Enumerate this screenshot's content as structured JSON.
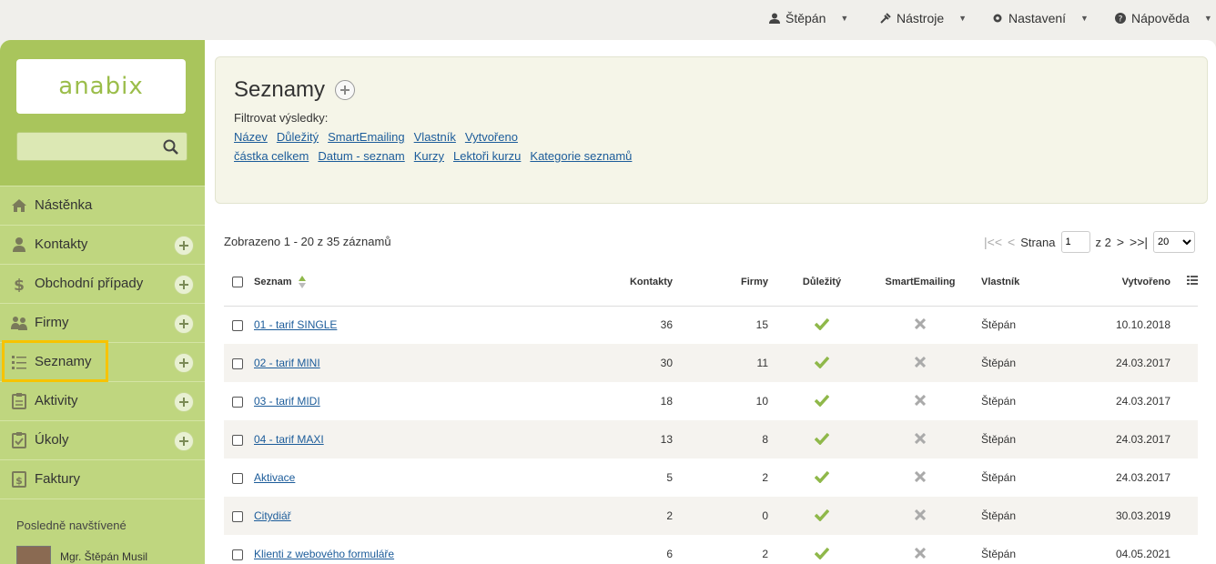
{
  "topbar": {
    "user": "Štěpán",
    "tools": "Nástroje",
    "settings": "Nastavení",
    "help": "Nápověda"
  },
  "sidebar": {
    "logo": "anabix",
    "search_placeholder": "",
    "items": [
      {
        "label": "Nástěnka",
        "icon": "home-icon",
        "plus": false
      },
      {
        "label": "Kontakty",
        "icon": "person-icon",
        "plus": true
      },
      {
        "label": "Obchodní případy",
        "icon": "dollar-icon",
        "plus": true
      },
      {
        "label": "Firmy",
        "icon": "group-icon",
        "plus": true
      },
      {
        "label": "Seznamy",
        "icon": "list-icon",
        "plus": true
      },
      {
        "label": "Aktivity",
        "icon": "clipboard-icon",
        "plus": true
      },
      {
        "label": "Úkoly",
        "icon": "task-icon",
        "plus": true
      },
      {
        "label": "Faktury",
        "icon": "invoice-icon",
        "plus": false
      }
    ],
    "recent_title": "Posledně navštívené",
    "recent_item": "Mgr. Štěpán Musil"
  },
  "main": {
    "title": "Seznamy",
    "filter_label": "Filtrovat výsledky:",
    "filters_row1": [
      "Název",
      "Důležitý",
      "SmartEmailing",
      "Vlastník",
      "Vytvořeno"
    ],
    "filters_row2": [
      "částka celkem",
      "Datum - seznam",
      "Kurzy",
      "Lektoři kurzu",
      "Kategorie seznamů"
    ],
    "showing": "Zobrazeno 1 - 20 z 35 záznamů",
    "pager": {
      "label": "Strana",
      "page": "1",
      "of": "z 2",
      "per_page": "20"
    }
  },
  "table": {
    "headers": {
      "name": "Seznam",
      "contacts": "Kontakty",
      "companies": "Firmy",
      "important": "Důležitý",
      "smartemailing": "SmartEmailing",
      "owner": "Vlastník",
      "created": "Vytvořeno"
    },
    "rows": [
      {
        "name": "01 - tarif SINGLE",
        "contacts": "36",
        "companies": "15",
        "owner": "Štěpán",
        "created": "10.10.2018"
      },
      {
        "name": "02 - tarif MINI",
        "contacts": "30",
        "companies": "11",
        "owner": "Štěpán",
        "created": "24.03.2017"
      },
      {
        "name": "03 - tarif MIDI",
        "contacts": "18",
        "companies": "10",
        "owner": "Štěpán",
        "created": "24.03.2017"
      },
      {
        "name": "04 - tarif MAXI",
        "contacts": "13",
        "companies": "8",
        "owner": "Štěpán",
        "created": "24.03.2017"
      },
      {
        "name": "Aktivace",
        "contacts": "5",
        "companies": "2",
        "owner": "Štěpán",
        "created": "24.03.2017"
      },
      {
        "name": "Citydiář",
        "contacts": "2",
        "companies": "0",
        "owner": "Štěpán",
        "created": "30.03.2019"
      },
      {
        "name": "Klienti z webového formuláře",
        "contacts": "6",
        "companies": "2",
        "owner": "Štěpán",
        "created": "04.05.2021"
      }
    ]
  },
  "colors": {
    "sidebar": "#bfd67f",
    "accent_green": "#8fb84a",
    "link": "#1c5c9a",
    "highlight": "#f7c300"
  }
}
